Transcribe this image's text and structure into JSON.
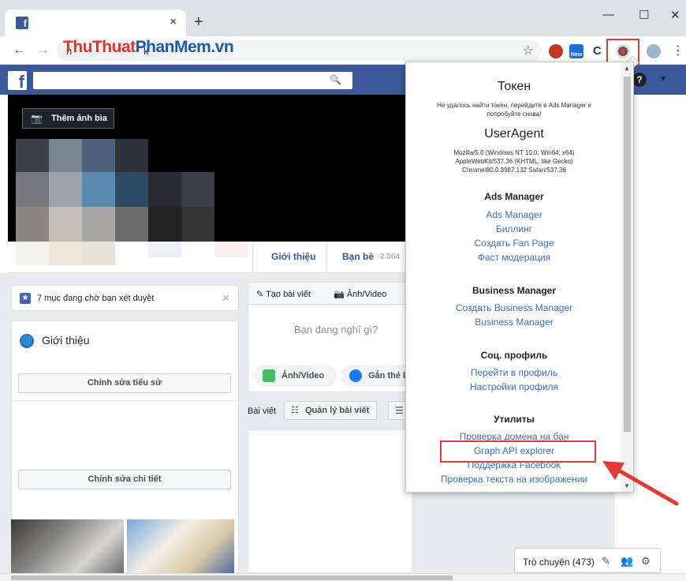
{
  "browser": {
    "tab_close": "×",
    "new_tab": "+",
    "win_minimize": "—",
    "win_maximize": "☐",
    "win_close": "✕",
    "back": "←",
    "forward": "→",
    "url_prefix": "h",
    "url_suffix": "k",
    "watermark_red": "ThuThuat",
    "watermark_blue": "PhanMem",
    "watermark_tail": ".vn",
    "star": "☆",
    "ext_new_label": "New",
    "ext_c_label": "C",
    "menu_dots": "⋮"
  },
  "facebook": {
    "logo": "f",
    "cover_button": "Thêm ảnh bìa",
    "tabs": {
      "about": "Giới thiệu",
      "friends": "Bạn bè",
      "friends_count": "2.064"
    },
    "notice": "7 mục đang chờ bạn xét duyệt",
    "intro_title": "Giới thiệu",
    "edit_bio": "Chỉnh sửa tiểu sử",
    "edit_details": "Chỉnh sửa chi tiết",
    "composer": {
      "tab_post": "Tạo bài viết",
      "tab_photo": "Ảnh/Video",
      "placeholder": "Bạn đang nghĩ gì?",
      "photo_pill": "Ảnh/Video",
      "tag_pill": "Gắn thẻ b"
    },
    "posts_label": "Bài viết",
    "manage_posts": "Quản lý bài viết",
    "chat_label": "Trò chuyện (473)"
  },
  "popup": {
    "token_title": "Токен",
    "token_msg": "Не удалось найти токен, перейдите в Ads Manager и попробуйте снова!",
    "ua_title": "UserAgent",
    "ua_line1": "Mozilla/5.0 (Windows NT 10.0; Win64; x64)",
    "ua_line2": "AppleWebKit/537.36 (KHTML, like Gecko)",
    "ua_line3": "Chrome/80.0.3987.132 Safari/537.36",
    "sections": {
      "ads": {
        "title": "Ads Manager",
        "links": [
          "Ads Manager",
          "Биллинг",
          "Создать Fan Page",
          "Фаст модерация"
        ]
      },
      "business": {
        "title": "Business Manager",
        "links": [
          "Создать Business Manager",
          "Business Manager"
        ]
      },
      "social": {
        "title": "Соц. профиль",
        "links": [
          "Перейти в профиль",
          "Настройки профиля"
        ]
      },
      "utils": {
        "title": "Утилиты",
        "links": [
          "Проверка домена на бан",
          "Graph API explorer",
          "Поддержка Facebook",
          "Проверка текста на изображении"
        ]
      }
    }
  },
  "colors": {
    "facebook_blue": "#3b5998",
    "link_blue": "#3b6fc2",
    "highlight_red": "#e53935"
  }
}
